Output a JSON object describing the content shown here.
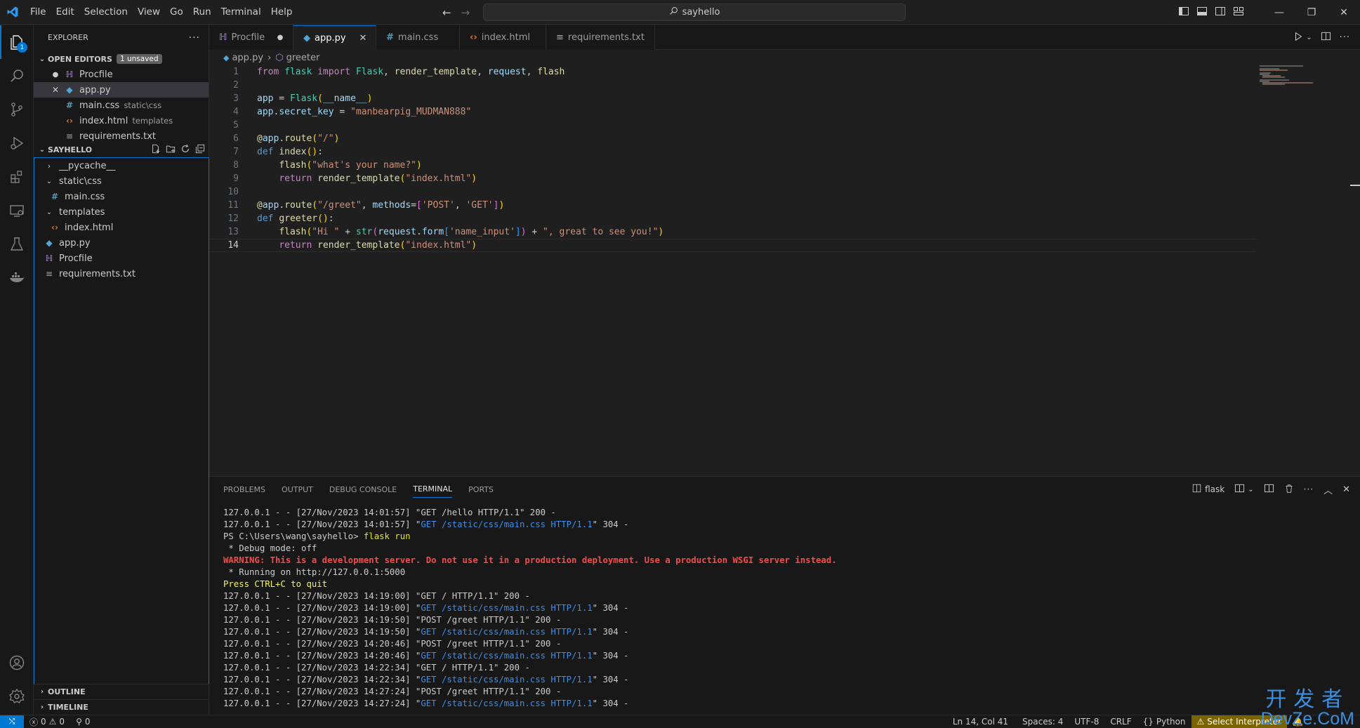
{
  "titlebar": {
    "menu": [
      "File",
      "Edit",
      "Selection",
      "View",
      "Go",
      "Run",
      "Terminal",
      "Help"
    ],
    "search_text": "sayhello"
  },
  "activity_badge": "1",
  "explorer": {
    "title": "EXPLORER",
    "more": "···",
    "open_editors": {
      "label": "OPEN EDITORS",
      "badge": "1 unsaved",
      "items": [
        {
          "name": "Procfile",
          "hint": "",
          "status": "●"
        },
        {
          "name": "app.py",
          "hint": "",
          "status": "✕"
        },
        {
          "name": "main.css",
          "hint": "static\\css",
          "status": ""
        },
        {
          "name": "index.html",
          "hint": "templates",
          "status": ""
        },
        {
          "name": "requirements.txt",
          "hint": "",
          "status": ""
        }
      ]
    },
    "folder": {
      "label": "SAYHELLO",
      "tree": [
        {
          "name": "__pycache__"
        },
        {
          "name": "static\\css"
        },
        {
          "name": "main.css"
        },
        {
          "name": "templates"
        },
        {
          "name": "index.html"
        },
        {
          "name": "app.py"
        },
        {
          "name": "Procfile"
        },
        {
          "name": "requirements.txt"
        }
      ]
    },
    "outline": "OUTLINE",
    "timeline": "TIMELINE"
  },
  "tabs": [
    {
      "name": "Procfile",
      "status": "●"
    },
    {
      "name": "app.py",
      "status": "✕"
    },
    {
      "name": "main.css",
      "status": ""
    },
    {
      "name": "index.html",
      "status": ""
    },
    {
      "name": "requirements.txt",
      "status": ""
    }
  ],
  "breadcrumb": {
    "file": "app.py",
    "symbol": "greeter"
  },
  "editor": {
    "line_numbers": [
      "1",
      "2",
      "3",
      "4",
      "5",
      "6",
      "7",
      "8",
      "9",
      "10",
      "11",
      "12",
      "13",
      "14"
    ],
    "current_line": 14
  },
  "panel": {
    "tabs": [
      "PROBLEMS",
      "OUTPUT",
      "DEBUG CONSOLE",
      "TERMINAL",
      "PORTS"
    ],
    "active_tab": "TERMINAL",
    "terminal_name": "flask",
    "terminal_lines": [
      {
        "a": "127.0.0.1 - - [27/Nov/2023 14:01:57] \"GET /hello HTTP/1.1\" 200 -",
        "b": "",
        "c": ""
      },
      {
        "a": "127.0.0.1 - - [27/Nov/2023 14:01:57] \"",
        "b": "GET /static/css/main.css HTTP/1.1",
        "c": "\" 304 -"
      },
      {
        "a": "PS C:\\Users\\wang\\sayhello> ",
        "b": "flask run",
        "c": "",
        "type": "cmd"
      },
      {
        "a": " * Debug mode: off",
        "b": "",
        "c": ""
      },
      {
        "a": "WARNING: This is a development server. Do not use it in a production deployment. Use a production WSGI server instead.",
        "b": "",
        "c": "",
        "type": "warn"
      },
      {
        "a": " * Running on http://127.0.0.1:5000",
        "b": "",
        "c": ""
      },
      {
        "a": "Press CTRL+C to quit",
        "b": "",
        "c": "",
        "type": "yellow"
      },
      {
        "a": "127.0.0.1 - - [27/Nov/2023 14:19:00] \"GET / HTTP/1.1\" 200 -",
        "b": "",
        "c": ""
      },
      {
        "a": "127.0.0.1 - - [27/Nov/2023 14:19:00] \"",
        "b": "GET /static/css/main.css HTTP/1.1",
        "c": "\" 304 -"
      },
      {
        "a": "127.0.0.1 - - [27/Nov/2023 14:19:50] \"POST /greet HTTP/1.1\" 200 -",
        "b": "",
        "c": ""
      },
      {
        "a": "127.0.0.1 - - [27/Nov/2023 14:19:50] \"",
        "b": "GET /static/css/main.css HTTP/1.1",
        "c": "\" 304 -"
      },
      {
        "a": "127.0.0.1 - - [27/Nov/2023 14:20:46] \"POST /greet HTTP/1.1\" 200 -",
        "b": "",
        "c": ""
      },
      {
        "a": "127.0.0.1 - - [27/Nov/2023 14:20:46] \"",
        "b": "GET /static/css/main.css HTTP/1.1",
        "c": "\" 304 -"
      },
      {
        "a": "127.0.0.1 - - [27/Nov/2023 14:22:34] \"GET / HTTP/1.1\" 200 -",
        "b": "",
        "c": ""
      },
      {
        "a": "127.0.0.1 - - [27/Nov/2023 14:22:34] \"",
        "b": "GET /static/css/main.css HTTP/1.1",
        "c": "\" 304 -"
      },
      {
        "a": "127.0.0.1 - - [27/Nov/2023 14:27:24] \"POST /greet HTTP/1.1\" 200 -",
        "b": "",
        "c": ""
      },
      {
        "a": "127.0.0.1 - - [27/Nov/2023 14:27:24] \"",
        "b": "GET /static/css/main.css HTTP/1.1",
        "c": "\" 304 -"
      }
    ]
  },
  "statusbar": {
    "errors": "0",
    "warnings": "0",
    "ports": "0",
    "position": "Ln 14, Col 41",
    "spaces": "Spaces: 4",
    "encoding": "UTF-8",
    "eol": "CRLF",
    "language": "Python",
    "interpreter": "Select Interpreter"
  },
  "watermark": {
    "cn": "开发者",
    "en": "DevZe.CoM"
  },
  "colors": {
    "accent": "#0078d4",
    "background": "#1f1f1f",
    "sidebar": "#181818",
    "warning_bg": "#7a6400"
  }
}
